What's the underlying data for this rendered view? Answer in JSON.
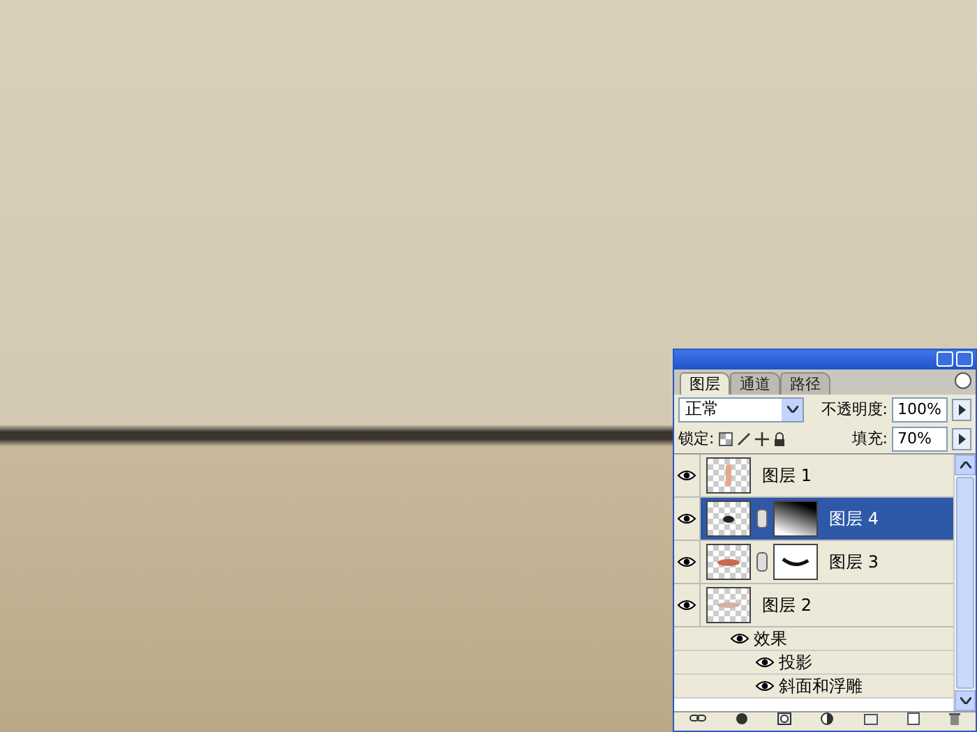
{
  "panel": {
    "tabs": [
      {
        "label": "图层",
        "selected": true
      },
      {
        "label": "通道",
        "selected": false
      },
      {
        "label": "路径",
        "selected": false
      }
    ],
    "blend_mode": "正常",
    "opacity_label": "不透明度:",
    "opacity": "100%",
    "lock_label": "锁定:",
    "fill_label": "填充:",
    "fill": "70%",
    "layers": [
      {
        "name": "图层 1",
        "visible": true,
        "selected": false,
        "kind": "figure",
        "mask": false
      },
      {
        "name": "图层 4",
        "visible": true,
        "selected": true,
        "kind": "shape",
        "mask": true
      },
      {
        "name": "图层 3",
        "visible": true,
        "selected": false,
        "kind": "lips",
        "mask": true
      },
      {
        "name": "图层 2",
        "visible": true,
        "selected": false,
        "kind": "smudge",
        "mask": false,
        "effects": {
          "label": "效果",
          "visible": true,
          "items": [
            {
              "label": "投影",
              "visible": true
            },
            {
              "label": "斜面和浮雕",
              "visible": true
            }
          ]
        }
      }
    ]
  }
}
